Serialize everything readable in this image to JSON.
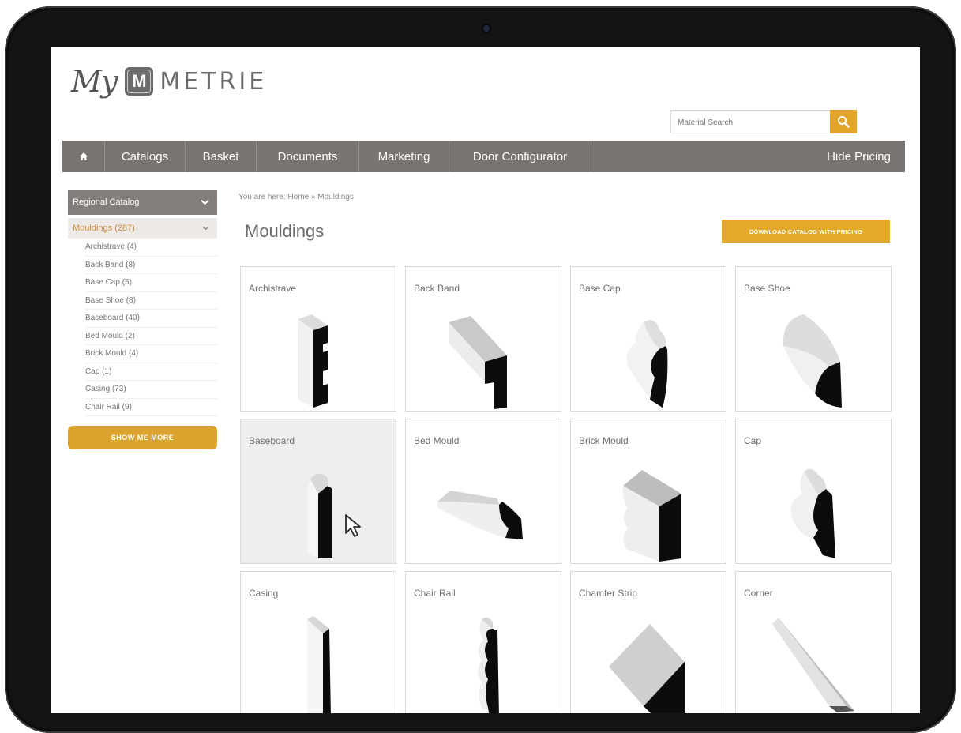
{
  "app": {
    "logo_prefix": "My",
    "logo_badge": "M",
    "logo_name": "METRIE"
  },
  "search": {
    "placeholder": "Material Search",
    "button_icon": "search-icon"
  },
  "nav": {
    "home_icon": "home-icon",
    "items": [
      "Catalogs",
      "Basket",
      "Documents",
      "Marketing",
      "Door Configurator"
    ],
    "right_label": "Hide Pricing"
  },
  "sidebar": {
    "catalog_select": "Regional Catalog",
    "category": "Mouldings (287)",
    "items": [
      "Archistrave (4)",
      "Back Band (8)",
      "Base Cap (5)",
      "Base Shoe (8)",
      "Baseboard (40)",
      "Bed Mould (2)",
      "Brick Mould (4)",
      "Cap (1)",
      "Casing (73)",
      "Chair Rail (9)"
    ],
    "show_more": "SHOW ME MORE"
  },
  "breadcrumb": "You are here: Home » Mouldings",
  "page_title": "Mouldings",
  "download_button": "DOWNLOAD CATALOG WITH PRICING",
  "products": [
    "Archistrave",
    "Back Band",
    "Base Cap",
    "Base Shoe",
    "Baseboard",
    "Bed Mould",
    "Brick Mould",
    "Cap",
    "Casing",
    "Chair Rail",
    "Chamfer Strip",
    "Corner"
  ],
  "colors": {
    "accent": "#e3a527",
    "nav_bg": "#7a7471",
    "category_text": "#d08b3b"
  }
}
